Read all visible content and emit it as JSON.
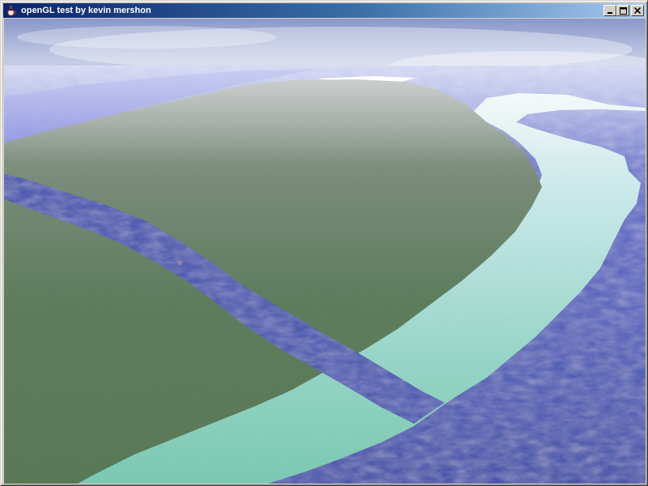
{
  "window": {
    "title": "openGL test by kevin mershon",
    "icon": "java-coffee-cup-icon",
    "controls": {
      "minimize_icon": "minimize-icon",
      "maximize_icon": "maximize-icon",
      "close_icon": "close-icon"
    }
  },
  "scene": {
    "type": "opengl-3d-terrain-render",
    "colors": {
      "sky_top": "#8996c6",
      "sky_haze": "#dde2f0",
      "grass": "#5e7f5e",
      "water": "#3f4fa8",
      "shallow_water": "#8fd3c4",
      "snow_bank": "#f4fbfc"
    }
  }
}
